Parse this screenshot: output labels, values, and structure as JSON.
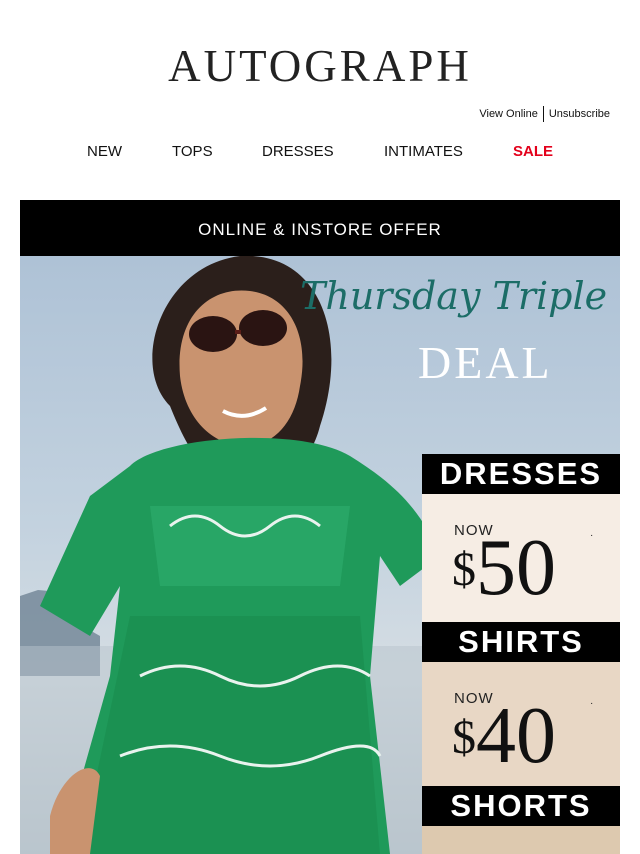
{
  "header": {
    "logo": "AUTOGRAPH",
    "view_online": "View Online",
    "unsubscribe": "Unsubscribe"
  },
  "nav": [
    "NEW",
    "TOPS",
    "DRESSES",
    "INTIMATES",
    "SALE"
  ],
  "hero": {
    "offer_bar": "ONLINE & INSTORE OFFER",
    "script_title": "Thursday Triple",
    "big_title": "DEAL",
    "deals": [
      {
        "category": "DRESSES",
        "now": "NOW",
        "currency": "$",
        "price": "50",
        "footnote": "·",
        "bg": "#f6ede4"
      },
      {
        "category": "SHIRTS",
        "now": "NOW",
        "currency": "$",
        "price": "40",
        "footnote": "·",
        "bg": "#e8d7c5"
      },
      {
        "category": "SHORTS",
        "bg": "#ddc9af"
      }
    ]
  },
  "colors": {
    "sale": "#e3001b",
    "script": "#1c6d67",
    "dress_green": "#1f9a5a"
  }
}
